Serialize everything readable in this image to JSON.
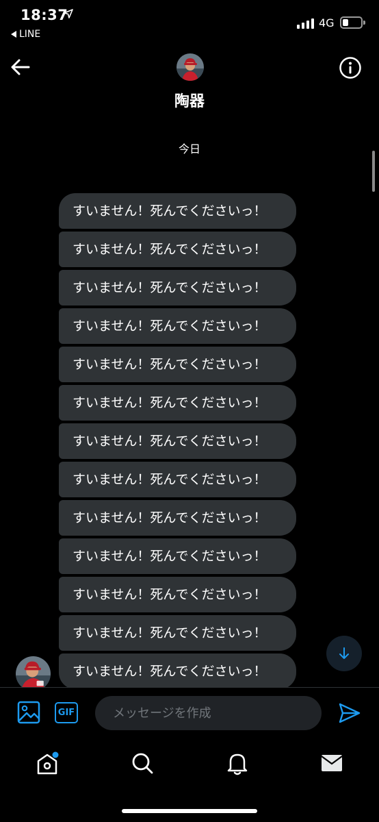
{
  "status_bar": {
    "time": "18:37",
    "back_app": "LINE",
    "network": "4G",
    "signal_bars": 4,
    "battery_level": 0.2
  },
  "header": {
    "title": "陶器"
  },
  "date_separator": "今日",
  "messages": [
    {
      "text": "すいません！死んでくださいっ！"
    },
    {
      "text": "すいません！死んでくださいっ！"
    },
    {
      "text": "すいません！死んでくださいっ！"
    },
    {
      "text": "すいません！死んでくださいっ！"
    },
    {
      "text": "すいません！死んでくださいっ！"
    },
    {
      "text": "すいません！死んでくださいっ！"
    },
    {
      "text": "すいません！死んでくださいっ！"
    },
    {
      "text": "すいません！死んでくださいっ！"
    },
    {
      "text": "すいません！死んでくださいっ！"
    },
    {
      "text": "すいません！死んでくださいっ！"
    },
    {
      "text": "すいません！死んでくださいっ！"
    },
    {
      "text": "すいません！死んでくださいっ！"
    },
    {
      "text": "すいません！死んでくださいっ！"
    }
  ],
  "composer": {
    "placeholder": "メッセージを作成",
    "gif_label": "GIF"
  },
  "colors": {
    "accent": "#1d9bf0",
    "bubble": "#2f3336",
    "background": "#000000"
  },
  "icons": {
    "back": "arrow-left-icon",
    "info": "info-icon",
    "media": "image-icon",
    "send": "send-icon",
    "scroll_down": "arrow-down-icon",
    "tabs": [
      "home-icon",
      "search-icon",
      "bell-icon",
      "mail-icon"
    ]
  }
}
